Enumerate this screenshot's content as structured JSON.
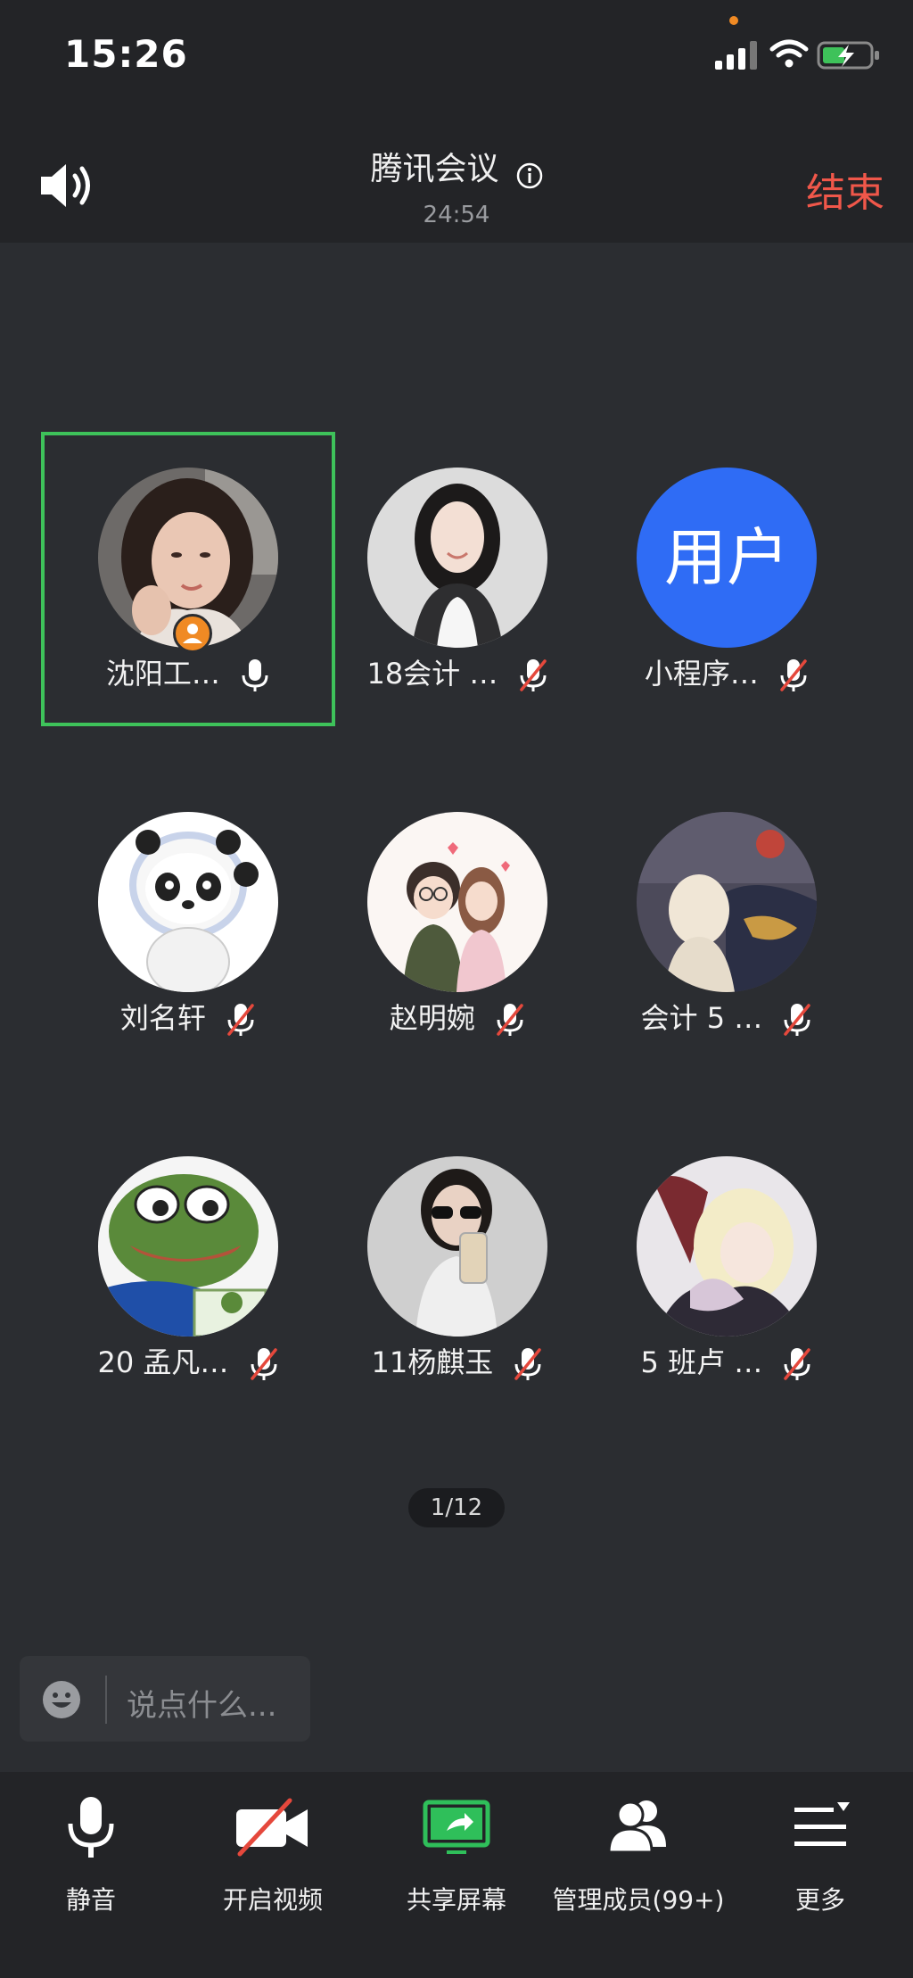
{
  "status_bar": {
    "time": "15:26"
  },
  "header": {
    "title": "腾讯会议",
    "duration": "24:54",
    "end_label": "结束"
  },
  "participants": [
    {
      "name": "沈阳工…",
      "mic": "on",
      "host": true,
      "avatar": "photo-woman-1",
      "active": true
    },
    {
      "name": "18会计 …",
      "mic": "muted",
      "avatar": "photo-woman-2"
    },
    {
      "name": "小程序…",
      "mic": "muted",
      "avatar_text": "用户",
      "avatar_color": "#2f6cf5"
    },
    {
      "name": "刘名轩",
      "mic": "muted",
      "avatar": "panda-mascot"
    },
    {
      "name": "赵明婉",
      "mic": "muted",
      "avatar": "cartoon-couple"
    },
    {
      "name": "会计 5 …",
      "mic": "muted",
      "avatar": "painting"
    },
    {
      "name": "20 孟凡…",
      "mic": "muted",
      "avatar": "pepe-frog"
    },
    {
      "name": "11杨麒玉",
      "mic": "muted",
      "avatar": "photo-woman-3"
    },
    {
      "name": "5 班卢 …",
      "mic": "muted",
      "avatar": "anime-art"
    }
  ],
  "pager": "1/12",
  "chat": {
    "placeholder": "说点什么..."
  },
  "toolbar": {
    "mute": "静音",
    "video": "开启视频",
    "share": "共享屏幕",
    "members": "管理成员(99+)",
    "more": "更多"
  },
  "colors": {
    "end": "#f0574a",
    "active_border": "#3ec25a",
    "share_green": "#2fbf5a",
    "host_badge": "#f08a24"
  }
}
